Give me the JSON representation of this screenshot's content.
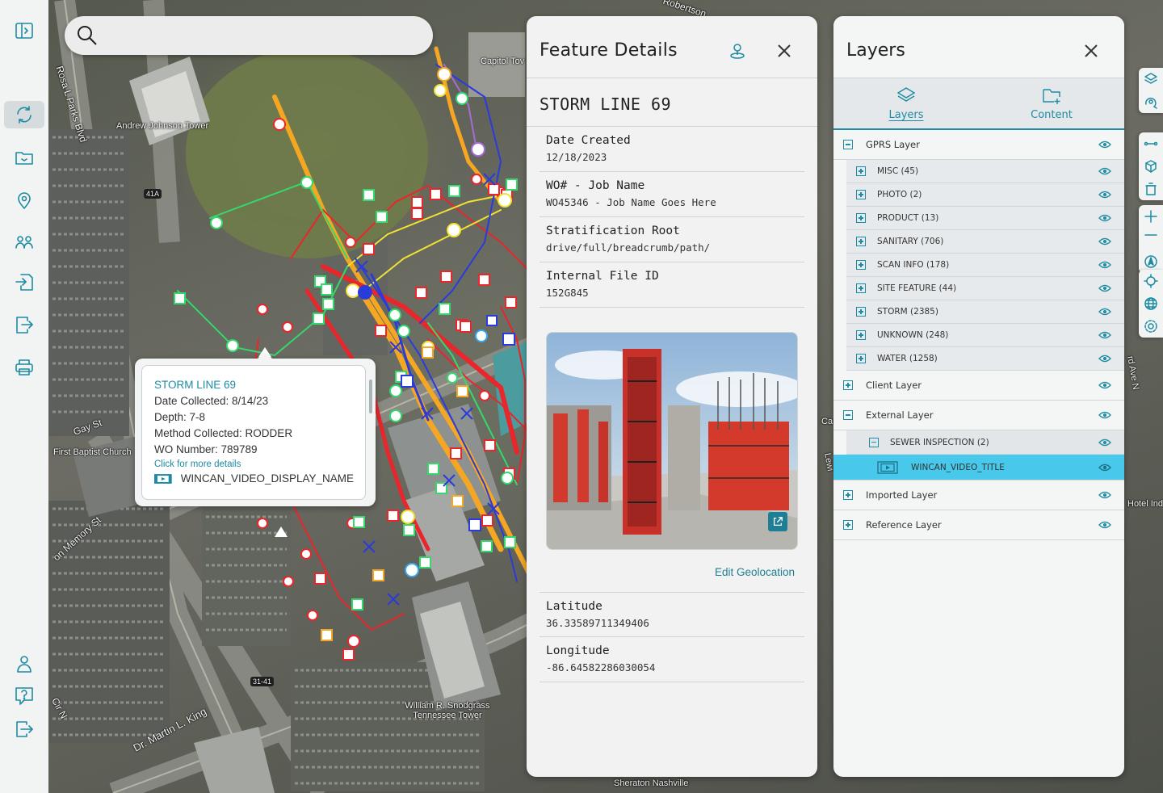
{
  "search": {
    "placeholder": ""
  },
  "nav": {
    "items": [
      {
        "icon": "sidebar-toggle-icon"
      },
      {
        "icon": "sync-icon",
        "active": true
      },
      {
        "icon": "folder-icon"
      },
      {
        "icon": "location-pin-icon"
      },
      {
        "icon": "users-icon"
      },
      {
        "icon": "import-icon"
      },
      {
        "icon": "export-icon"
      },
      {
        "icon": "print-icon"
      },
      {
        "icon": "user-icon"
      },
      {
        "icon": "help-icon"
      },
      {
        "icon": "logout-icon"
      }
    ]
  },
  "map": {
    "labels": [
      "Andrew Johnson Tower",
      "Rosa L Parks Blvd",
      "Capitol Tov",
      "41A",
      "Gay St",
      "First Baptist Church",
      "Dr. Martin L. King",
      "William R. Snodgrass Tennessee Tower",
      "Sheraton Nashville",
      "31-41",
      "Robertson",
      "Hotel Ind",
      "rd Ave N",
      "Ca",
      "Lewi",
      "on Memory St",
      "Cir N"
    ]
  },
  "popup": {
    "title": "STORM LINE 69",
    "lines": [
      "Date Collected: 8/14/23",
      "Depth: 7-8",
      "Method Collected: RODDER",
      "WO Number: 789789"
    ],
    "link": "Click for more details",
    "video": "WINCAN_VIDEO_DISPLAY_NAME"
  },
  "feature": {
    "header": "Feature Details",
    "name": "STORM LINE 69",
    "fields": [
      {
        "label": "Date Created",
        "value": "12/18/2023"
      },
      {
        "label": "WO# - Job Name",
        "value": "WO45346 - Job Name Goes Here"
      },
      {
        "label": "Stratification Root",
        "value": "drive/full/breadcrumb/path/"
      },
      {
        "label": "Internal File ID",
        "value": "152G845"
      }
    ],
    "edit_geolocation": "Edit Geolocation",
    "coords": [
      {
        "label": "Latitude",
        "value": "36.33589711349406"
      },
      {
        "label": "Longitude",
        "value": "-86.64582286030054"
      }
    ]
  },
  "layers": {
    "header": "Layers",
    "tabs": [
      {
        "label": "Layers",
        "icon": "layers-icon",
        "active": true
      },
      {
        "label": "Content",
        "icon": "add-file-icon",
        "active": false
      }
    ],
    "gprs": {
      "label": "GPRS Layer",
      "children": [
        "MISC (45)",
        "PHOTO (2)",
        "PRODUCT (13)",
        "SANITARY (706)",
        "SCAN INFO (178)",
        "SITE FEATURE (44)",
        "STORM (2385)",
        "UNKNOWN (248)",
        "WATER (1258)"
      ]
    },
    "client": "Client Layer",
    "external": {
      "label": "External Layer",
      "sewer": "SEWER INSPECTION (2)",
      "video": "WINCAN_VIDEO_TITLE"
    },
    "imported": "Imported Layer",
    "reference": "Reference Layer"
  },
  "colors": {
    "accent": "#1d8ba3",
    "selected_row": "#48c8ea",
    "storm_red": "#e8262b",
    "utility_orange": "#f5a623",
    "utility_yellow": "#f1e232",
    "utility_green": "#35d86a",
    "utility_blue": "#2a3bdc"
  }
}
